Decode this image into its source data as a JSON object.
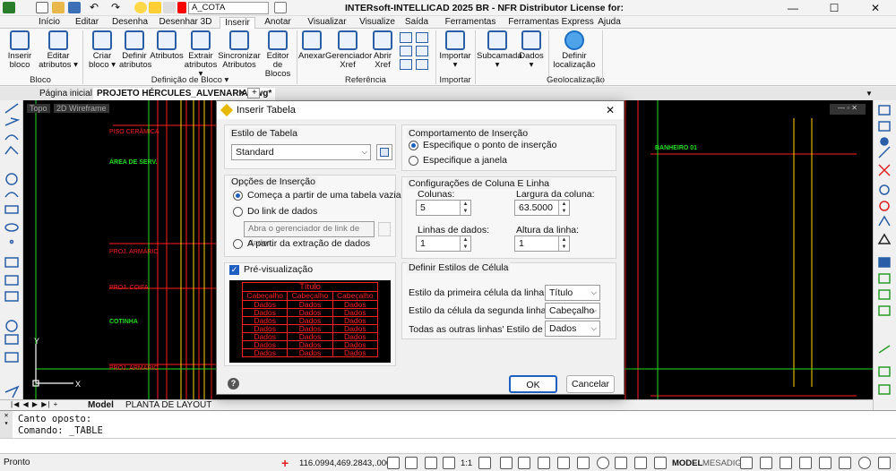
{
  "titlebar": {
    "layer_name": "A_COTA",
    "title": "INTERsoft-INTELLICAD 2025 BR - NFR Distributor License for:",
    "minimize": "—",
    "maximize": "☐",
    "close": "✕"
  },
  "menu_tabs": [
    "Início",
    "Editar",
    "Desenha",
    "Desenhar 3D",
    "Inserir",
    "Anotar",
    "Visualizar",
    "Visualize",
    "Saída",
    "Ferramentas",
    "Ferramentas Express",
    "Ajuda"
  ],
  "ribbon": {
    "bloco": {
      "group": "Bloco",
      "buttons": [
        "Inserir bloco",
        "Editar atributos ▾"
      ]
    },
    "defbloco": {
      "group": "Definição de Bloco ▾",
      "buttons": [
        "Criar bloco ▾",
        "Definir atributos",
        "Atributos",
        "Extrair atributos ▾",
        "Sincronizar Atributos",
        "Editor de Blocos"
      ]
    },
    "referencia": {
      "group": "Referência",
      "buttons": [
        "Anexar",
        "Gerenciador Xref",
        "Abrir Xref"
      ]
    },
    "importar": {
      "group": "Importar",
      "buttons": [
        "Importar ▾"
      ]
    },
    "subcamada": {
      "buttons": [
        "Subcamada ▾",
        "Dados ▾"
      ]
    },
    "geo": {
      "group": "Geolocalização",
      "buttons": [
        "Definir localização"
      ]
    }
  },
  "doc_tabs": {
    "home": "Página inicial",
    "file": "PROJETO HÉRCULES_ALVENARIA.dwg*",
    "close": "✕",
    "add": "+"
  },
  "viewport_labels": {
    "view": "Topo",
    "style": "2D Wireframe"
  },
  "drawing_labels": [
    "ÁREA DE SERV.",
    "PISO CERÂMICA",
    "PROJ. ARMÁRIO",
    "PROJ. COIFA",
    "COTINHA",
    "PROJ. ARMÁRIO",
    "BANHEIRO 01",
    "PROJ. ARMÁRIO"
  ],
  "layout_tabs": {
    "model": "Model",
    "layout": "PLANTA DE LAYOUT"
  },
  "command": {
    "line1": "Canto oposto:",
    "line2": "Comando: _TABLE"
  },
  "status": {
    "ready": "Pronto",
    "coords": "116.0994,469.2843,.0000",
    "scale": "1:1",
    "model": "MODEL",
    "mesadig": "MESADIG"
  },
  "dialog": {
    "title": "Inserir Tabela",
    "close": "✕",
    "estilo": {
      "label": "Estilo de Tabela",
      "value": "Standard"
    },
    "opcoes": {
      "label": "Opções de Inserção",
      "opt1": "Começa a partir de uma tabela vazia",
      "opt2": "Do link de dados",
      "link_placeholder": "Abra o gerenciador de link de dados",
      "opt3": "A partir da extração de dados",
      "selected": "opt1"
    },
    "preview": {
      "checkbox": "Pré-visualização",
      "checked": true,
      "title": "Título",
      "headers": [
        "Cabeçalho",
        "Cabeçalho",
        "Cabeçalho"
      ],
      "rows": [
        [
          "Dados",
          "Dados",
          "Dados"
        ],
        [
          "Dados",
          "Dados",
          "Dados"
        ],
        [
          "Dados",
          "Dados",
          "Dados"
        ],
        [
          "Dados",
          "Dados",
          "Dados"
        ],
        [
          "Dados",
          "Dados",
          "Dados"
        ],
        [
          "Dados",
          "Dados",
          "Dados"
        ],
        [
          "Dados",
          "Dados",
          "Dados"
        ]
      ]
    },
    "comportamento": {
      "label": "Comportamento de Inserção",
      "opt1": "Especifique o ponto de inserção",
      "opt2": "Especifique a janela",
      "selected": "opt1"
    },
    "config": {
      "label": "Configurações de Coluna E Linha",
      "colunas_label": "Colunas:",
      "colunas": "5",
      "largura_label": "Largura da coluna:",
      "largura": "63.5000",
      "linhas_label": "Linhas de dados:",
      "linhas": "1",
      "altura_label": "Altura da linha:",
      "altura": "1"
    },
    "estilos_celula": {
      "label": "Definir Estilos de Célula",
      "primeira_label": "Estilo da primeira célula da linha:",
      "primeira": "Título",
      "segunda_label": "Estilo da célula da segunda linha:",
      "segunda": "Cabeçalho",
      "outras_label": "Todas as outras linhas' Estilo de célula:",
      "outras": "Dados"
    },
    "ok": "OK",
    "cancel": "Cancelar",
    "help": "?"
  },
  "colors": {
    "accent": "#1f5fbf",
    "cad_red": "#ff2020",
    "cad_yellow": "#ffd800",
    "cad_green": "#22dd22"
  }
}
